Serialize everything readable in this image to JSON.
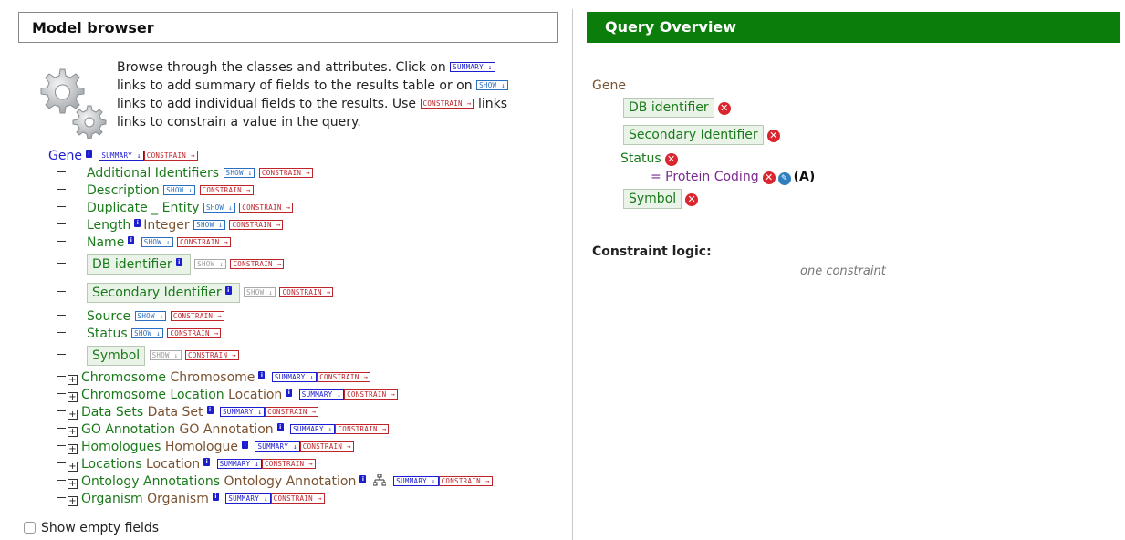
{
  "model_browser": {
    "title": "Model browser",
    "help": {
      "p1": "Browse through the classes and attributes. Click on",
      "p2": "links to add summary of fields to the results table or on",
      "p3": "links to add individual fields to the results. Use",
      "p4": "links to constrain a value in the query."
    },
    "tags": {
      "summary": "SUMMARY ↓",
      "show": "SHOW ↓",
      "constrain": "CONSTRAIN →"
    },
    "root": {
      "label": "Gene"
    },
    "info_badge": "i",
    "expand_glyph": "+",
    "attributes": [
      {
        "name": "Additional Identifiers"
      },
      {
        "name": "Description"
      },
      {
        "name": "Duplicate _ Entity"
      },
      {
        "name": "Length",
        "type": "Integer"
      },
      {
        "name": "Name"
      },
      {
        "name": "DB identifier"
      },
      {
        "name": "Secondary Identifier"
      },
      {
        "name": "Source"
      },
      {
        "name": "Status"
      },
      {
        "name": "Symbol"
      }
    ],
    "references": [
      {
        "name": "Chromosome",
        "type": "Chromosome"
      },
      {
        "name": "Chromosome Location",
        "type": "Location"
      },
      {
        "name": "Data Sets",
        "type": "Data Set"
      },
      {
        "name": "GO Annotation",
        "type": "GO Annotation"
      },
      {
        "name": "Homologues",
        "type": "Homologue"
      },
      {
        "name": "Locations",
        "type": "Location"
      },
      {
        "name": "Ontology Annotations",
        "type": "Ontology Annotation"
      },
      {
        "name": "Organism",
        "type": "Organism"
      }
    ],
    "show_empty_fields": "Show empty fields"
  },
  "query_overview": {
    "title": "Query Overview",
    "root": "Gene",
    "items": {
      "db_identifier": "DB identifier",
      "secondary_identifier": "Secondary Identifier",
      "status": "Status",
      "constraint": "= Protein Coding",
      "constraint_code": "(A)",
      "symbol": "Symbol"
    },
    "remove_glyph": "✕",
    "edit_glyph": "✎",
    "constraint_logic_title": "Constraint logic:",
    "constraint_logic_text": "one constraint"
  },
  "colors": {
    "header_green": "#0b7d0b",
    "field_green": "#1a7a1a",
    "class_blue": "#1d1dd0",
    "type_brown": "#7a5230",
    "constrain_red": "#c0242b",
    "remove_red": "#d9262f"
  }
}
